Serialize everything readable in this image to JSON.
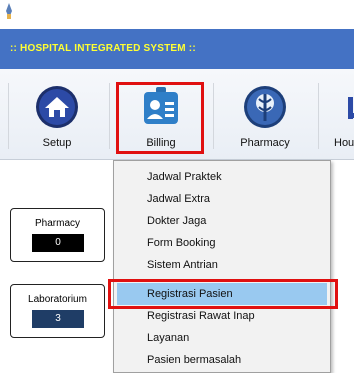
{
  "window": {
    "app_icon": "pen-icon"
  },
  "banner": {
    "title": ":: HOSPITAL INTEGRATED SYSTEM ::"
  },
  "toolbar": {
    "items": [
      {
        "label": "Setup",
        "icon": "home-icon"
      },
      {
        "label": "Billing",
        "icon": "billing-badge-icon"
      },
      {
        "label": "Pharmacy",
        "icon": "caduceus-icon"
      },
      {
        "label": "Hou",
        "icon": "partial-icon"
      }
    ]
  },
  "cards": [
    {
      "title": "Pharmacy",
      "value": "0"
    },
    {
      "title": "Laboratorium",
      "value": "3"
    }
  ],
  "billing_menu": {
    "items": [
      "Jadwal Praktek",
      "Jadwal Extra",
      "Dokter Jaga",
      "Form Booking",
      "Sistem Antrian",
      "Registrasi Pasien",
      "Registrasi Rawat Inap",
      "Layanan",
      "Pasien bermasalah"
    ],
    "selected": "Registrasi Pasien"
  },
  "colors": {
    "banner_bg": "#4472c4",
    "banner_text": "#ffff33",
    "highlight": "#e01010",
    "menu_selected": "#99c9f0"
  }
}
